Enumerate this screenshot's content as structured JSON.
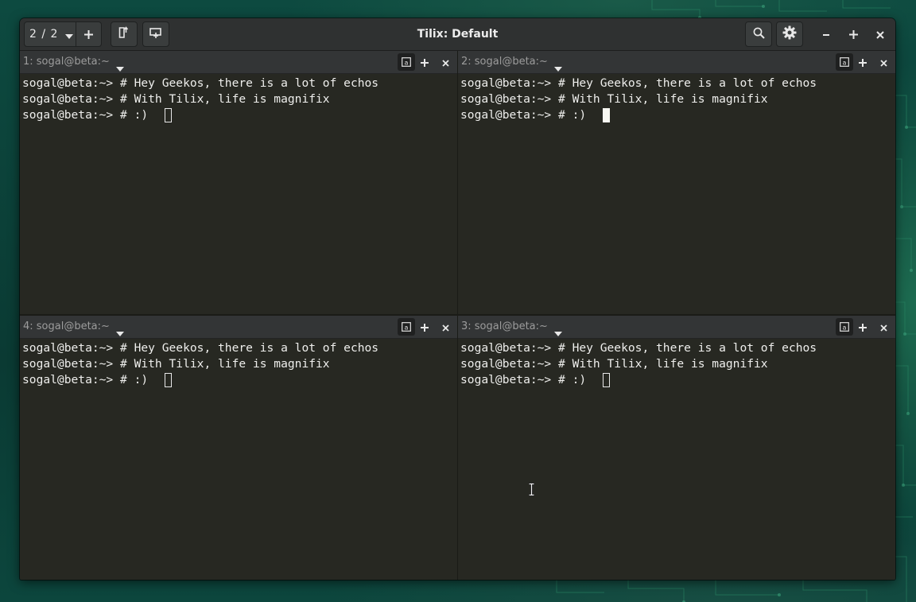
{
  "window": {
    "title": "Tilix: Default"
  },
  "headerbar": {
    "session_count": "2 / 2",
    "icons": {
      "session_menu": "chevron-down-icon",
      "add_session": "plus-icon",
      "sync_input": "sync-input-icon",
      "new_window": "new-window-icon",
      "search": "search-icon",
      "preferences": "gear-icon",
      "minimize": "minimize-icon",
      "maximize": "maximize-icon",
      "close": "close-icon"
    }
  },
  "terminals": [
    {
      "title": "1: sogal@beta:~",
      "lines": [
        "sogal@beta:~> # Hey Geekos, there is a lot of echos",
        "sogal@beta:~> # With Tilix, life is magnifix",
        "sogal@beta:~> # :)"
      ],
      "focused": false
    },
    {
      "title": "2: sogal@beta:~",
      "lines": [
        "sogal@beta:~> # Hey Geekos, there is a lot of echos",
        "sogal@beta:~> # With Tilix, life is magnifix",
        "sogal@beta:~> # :)"
      ],
      "focused": true
    },
    {
      "title": "4: sogal@beta:~",
      "lines": [
        "sogal@beta:~> # Hey Geekos, there is a lot of echos",
        "sogal@beta:~> # With Tilix, life is magnifix",
        "sogal@beta:~> # :)"
      ],
      "focused": false
    },
    {
      "title": "3: sogal@beta:~",
      "lines": [
        "sogal@beta:~> # Hey Geekos, there is a lot of echos",
        "sogal@beta:~> # With Tilix, life is magnifix",
        "sogal@beta:~> # :)"
      ],
      "focused": false
    }
  ],
  "colors": {
    "terminal_background": "#272822",
    "terminal_foreground": "#eeeeec",
    "headerbar": "#2f3131",
    "terminal_titlebar": "#333536",
    "desktop": "#0b3f37"
  }
}
